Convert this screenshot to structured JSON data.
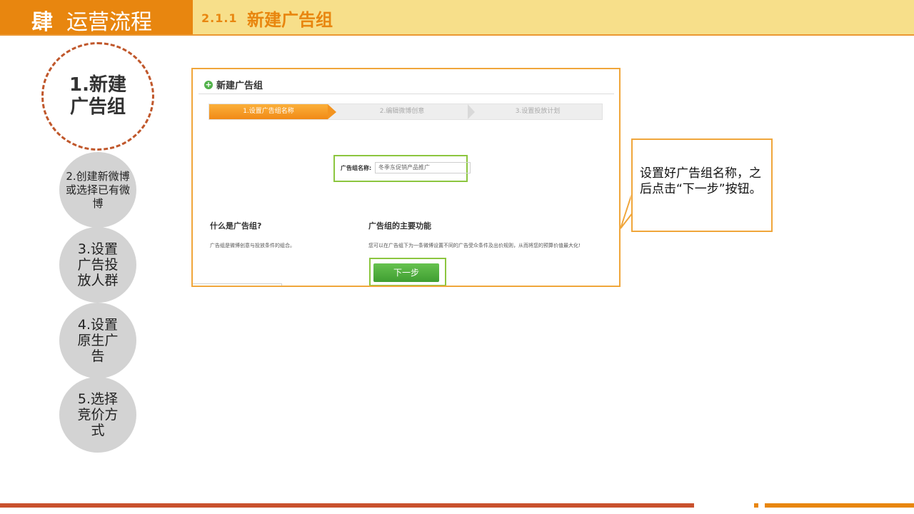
{
  "header": {
    "section_number": "肆",
    "section_title": "运营流程",
    "sub_number": "2.1.1",
    "sub_title": "新建广告组"
  },
  "steps": [
    {
      "label": "1.新建广告组",
      "active": true
    },
    {
      "label": "2.创建新微博或选择已有微博",
      "active": false
    },
    {
      "label": "3.设置广告投放人群",
      "active": false
    },
    {
      "label": "4.设置原生广告",
      "active": false
    },
    {
      "label": "5.选择竞价方式",
      "active": false
    }
  ],
  "screenshot": {
    "panel_title": "新建广告组",
    "progress": {
      "step1": "1.设置广告组名称",
      "step2": "2.编辑微博创意",
      "step3": "3.设置投放计划"
    },
    "name_label": "广告组名称:",
    "name_value": "冬季东促销产品推广",
    "what_title": "什么是广告组?",
    "what_text": "广告组是微博创意与投放条件的组合。",
    "func_title": "广告组的主要功能",
    "func_text": "您可以在广告组下为一条微博设置不同的广告受众条件及出价规则，从而将您的预算价值最大化!",
    "next_button": "下一步"
  },
  "callout": {
    "text": "设置好广告组名称，之后点击“下一步”按钮。"
  },
  "colors": {
    "orange": "#e8860f",
    "light_yellow": "#f7df8a",
    "red": "#c9512d",
    "green": "#8cc63f"
  }
}
